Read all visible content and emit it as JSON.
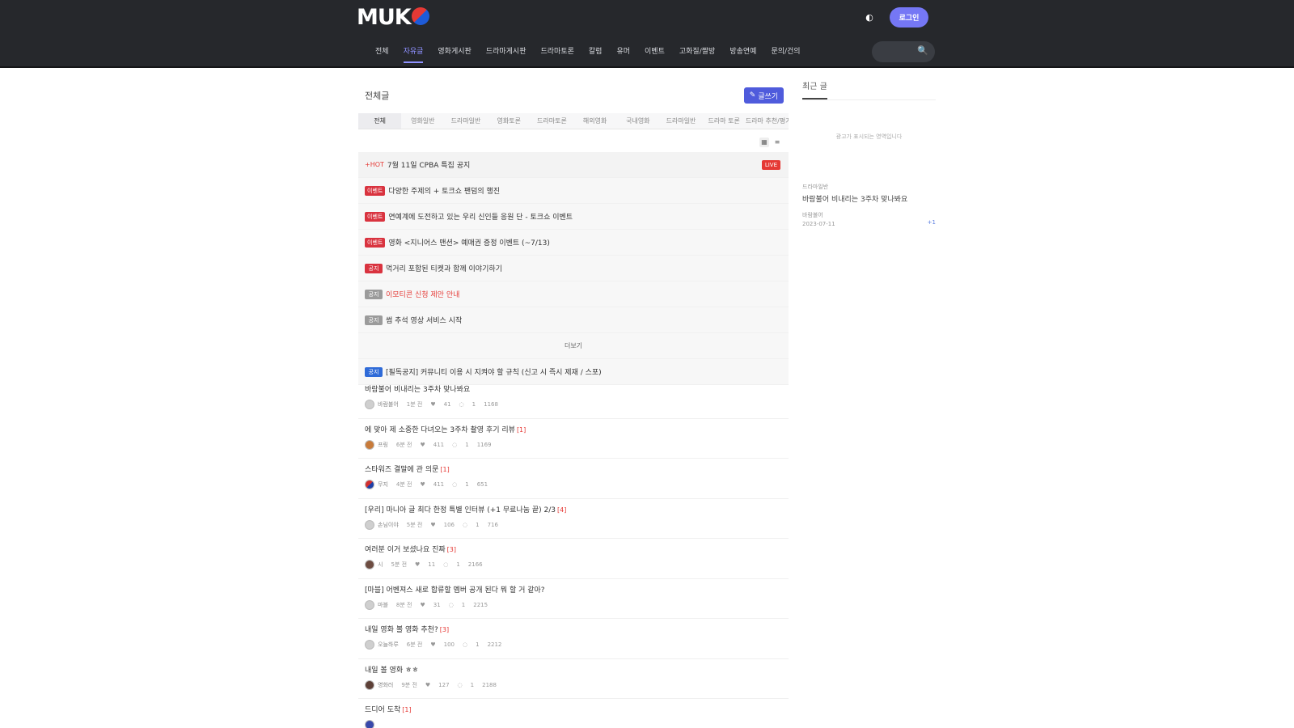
{
  "header": {
    "logo_text": "MUK",
    "login_label": "로그인",
    "theme_icon": "◐",
    "search_icon": "🔍",
    "nav": [
      {
        "label": "전체"
      },
      {
        "label": "자유글"
      },
      {
        "label": "영화게시판"
      },
      {
        "label": "드라마게시판"
      },
      {
        "label": "드라마토론"
      },
      {
        "label": "칼럼"
      },
      {
        "label": "유머"
      },
      {
        "label": "이벤트"
      },
      {
        "label": "고화질/짤방"
      },
      {
        "label": "방송연예"
      },
      {
        "label": "문의/건의"
      }
    ]
  },
  "main": {
    "board_title": "전체글",
    "write_label": "글쓰기",
    "write_icon": "✎",
    "tabs": [
      {
        "label": "전체"
      },
      {
        "label": "영화일반"
      },
      {
        "label": "드라마일반"
      },
      {
        "label": "영화토론"
      },
      {
        "label": "드라마토론"
      },
      {
        "label": "해외영화"
      },
      {
        "label": "국내영화"
      },
      {
        "label": "드라마일반"
      },
      {
        "label": "드라마 토론"
      },
      {
        "label": "드라마 추천/평가"
      }
    ],
    "view_toggle": [
      "▦",
      "≡"
    ],
    "notices": [
      {
        "prefix": "+HOT",
        "text": "7월 11일 CPBA 특집 공지",
        "badge": "",
        "badge_color": "",
        "live": "LIVE",
        "text_red": false
      },
      {
        "prefix": "",
        "text": "다양한 주제의 + 토크쇼 팬덤의 행진",
        "badge": "이벤트",
        "badge_color": "red",
        "live": "",
        "text_red": false
      },
      {
        "prefix": "",
        "text": "연예계에 도전하고 있는 우리 신인들 응원 단 - 토크쇼 이벤트",
        "badge": "이벤트",
        "badge_color": "red",
        "live": "",
        "text_red": false
      },
      {
        "prefix": "",
        "text": "영화 <지니어스 맨션> 예매권 증정 이벤트 (~7/13)",
        "badge": "이벤트",
        "badge_color": "red",
        "live": "",
        "text_red": false
      },
      {
        "prefix": "",
        "text": "먹거리 포함된 티켓과 함께 이야기하기",
        "badge": "공지",
        "badge_color": "red",
        "live": "",
        "text_red": false
      },
      {
        "prefix": "",
        "text": "이모티콘 신청 제안 안내",
        "badge": "공지",
        "badge_color": "gray",
        "live": "",
        "text_red": true
      },
      {
        "prefix": "",
        "text": "썸 추석 영상 서비스 시작",
        "badge": "공지",
        "badge_color": "gray",
        "live": "",
        "text_red": false
      }
    ],
    "more_label": "더보기",
    "pinned": {
      "badge": "공지",
      "text": "[필독공지] 커뮤니티 이용 시 지켜야 할 규칙 (신고 시 즉시 제재 / 스포)"
    },
    "posts": [
      {
        "title": "바람불어 비내리는 3주차 맞나봐요",
        "comments": "",
        "author": "바람불어",
        "time": "1분 전",
        "likes": "41",
        "replies": "1",
        "views": "1168"
      },
      {
        "title": "에 맞아 제 소중한 다녀오는 3주차 촬영 후기 리뷰",
        "comments": "[1]",
        "author": "프링",
        "time": "6분 전",
        "likes": "411",
        "replies": "1",
        "views": "1169"
      },
      {
        "title": "스타워즈 결말에 관 의문",
        "comments": "[1]",
        "author": "무지",
        "time": "4분 전",
        "likes": "411",
        "replies": "1",
        "views": "651"
      },
      {
        "title": "[우리] 마니아 글 최다 한정 특별 인터뷰 (+1 무료나눔 끝) 2/3",
        "comments": "[4]",
        "author": "손님이야",
        "time": "5분 전",
        "likes": "106",
        "replies": "1",
        "views": "716"
      },
      {
        "title": "여러분 이거 보셨나요 진짜",
        "comments": "[3]",
        "author": "시",
        "time": "5분 전",
        "likes": "11",
        "replies": "1",
        "views": "2166"
      },
      {
        "title": "[마블] 어벤져스 새로 합류할 멤버 공개 된다 뭐 할 거 같아?",
        "comments": "",
        "author": "마블",
        "time": "8분 전",
        "likes": "31",
        "replies": "1",
        "views": "2215"
      },
      {
        "title": "내일 영화 볼 영화 추천?",
        "comments": "[3]",
        "author": "오늘하루",
        "time": "6분 전",
        "likes": "100",
        "replies": "1",
        "views": "2212"
      },
      {
        "title": "내일 볼 영화 ㅎㅎ",
        "comments": "",
        "author": "영화러",
        "time": "9분 전",
        "likes": "127",
        "replies": "1",
        "views": "2188"
      },
      {
        "title": "드디어 도착",
        "comments": "[1]",
        "author": "",
        "time": "",
        "likes": "",
        "replies": "",
        "views": ""
      }
    ]
  },
  "sidebar": {
    "title": "최근 글",
    "ad_text": "광고가 표시되는 영역입니다",
    "post": {
      "category": "드라마일반",
      "title": "바람불어 비내리는 3주차 맞나봐요",
      "author": "바람불어",
      "date": "2023-07-11",
      "count": "+1"
    }
  },
  "colors": {
    "header_bg": "#26282c",
    "accent": "#7577f5",
    "nav_active": "#8f91ff",
    "write_button": "#4f5bdc",
    "badge_red": "#d9333f",
    "comment_red": "#e53935"
  }
}
